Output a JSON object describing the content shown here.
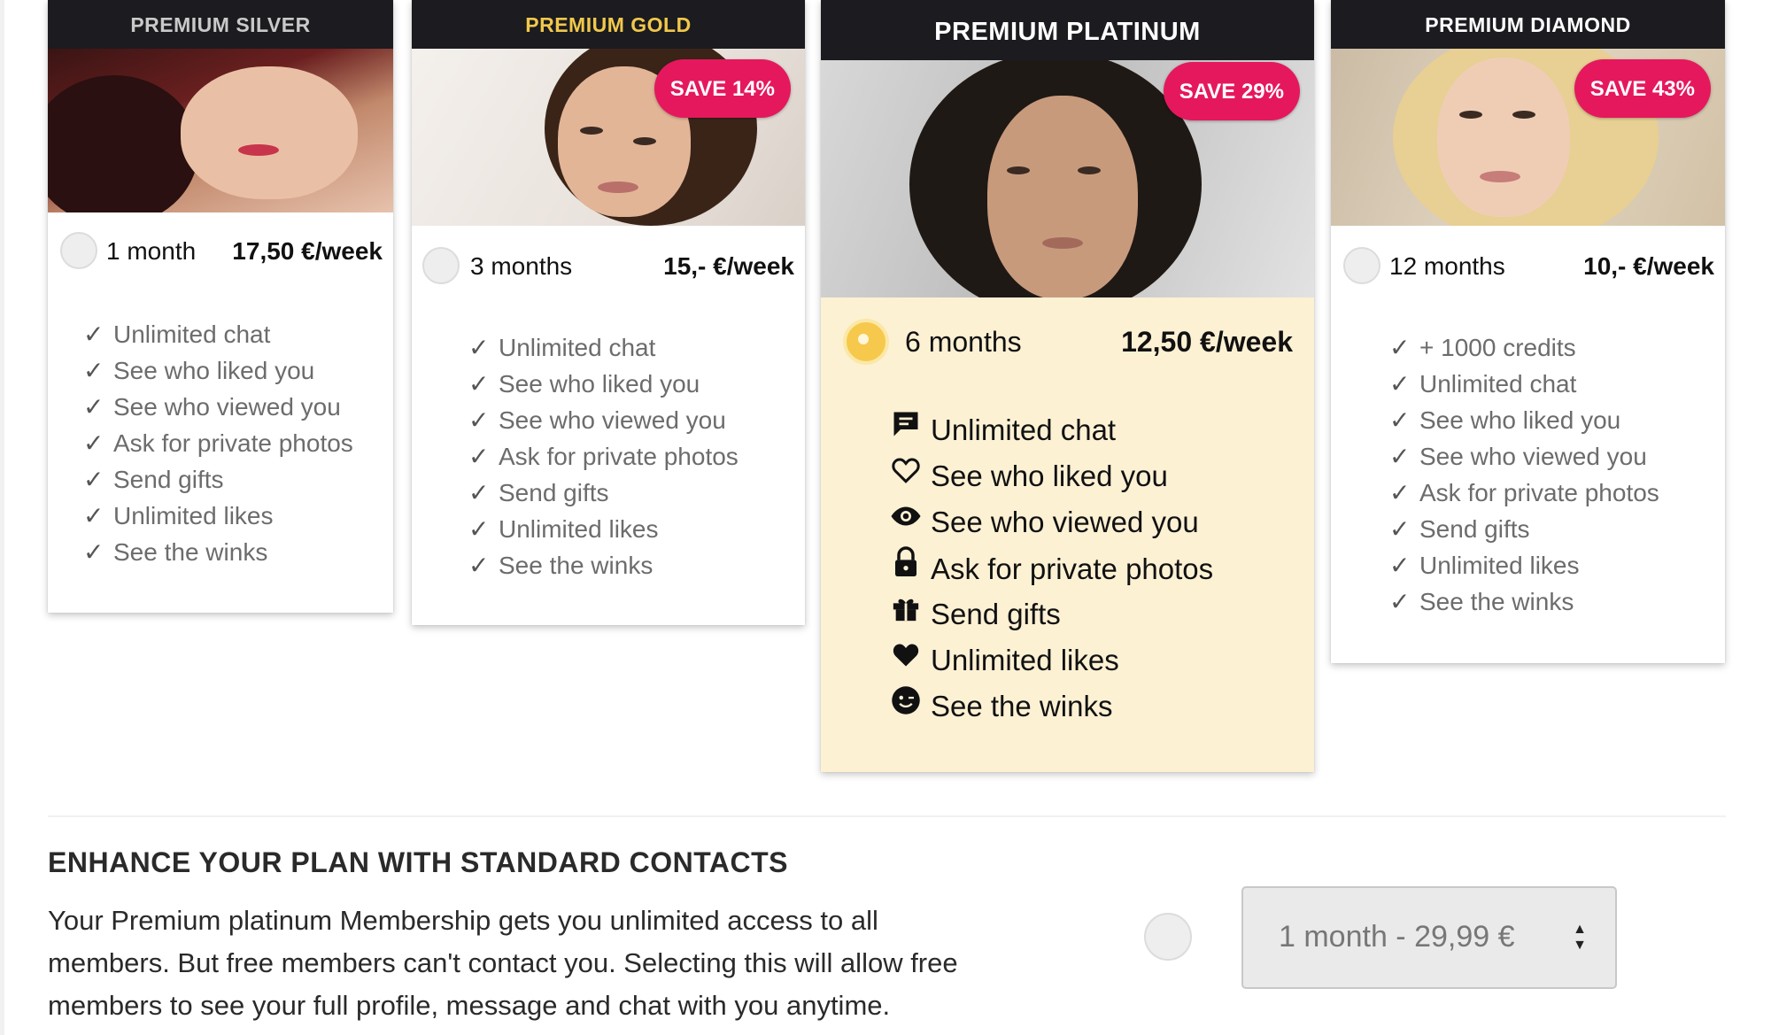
{
  "plans": [
    {
      "id": "silver",
      "header": "PREMIUM SILVER",
      "duration": "1 month",
      "price": "17,50 €/week",
      "features": [
        "Unlimited chat",
        "See who liked you",
        "See who viewed you",
        "Ask for private photos",
        "Send gifts",
        "Unlimited likes",
        "See the winks"
      ]
    },
    {
      "id": "gold",
      "header": "PREMIUM GOLD",
      "badge": "SAVE 14%",
      "duration": "3 months",
      "price": "15,- €/week",
      "features": [
        "Unlimited chat",
        "See who liked you",
        "See who viewed you",
        "Ask for private photos",
        "Send gifts",
        "Unlimited likes",
        "See the winks"
      ]
    },
    {
      "id": "platinum",
      "header": "PREMIUM PLATINUM",
      "badge": "SAVE 29%",
      "duration": "6 months",
      "price": "12,50 €/week",
      "selected": true,
      "features": [
        {
          "icon": "chat-icon",
          "label": "Unlimited chat"
        },
        {
          "icon": "heart-outline-icon",
          "label": "See who liked you"
        },
        {
          "icon": "eye-icon",
          "label": "See who viewed you"
        },
        {
          "icon": "lock-icon",
          "label": "Ask for private photos"
        },
        {
          "icon": "gift-icon",
          "label": "Send gifts"
        },
        {
          "icon": "heart-icon",
          "label": "Unlimited likes"
        },
        {
          "icon": "wink-icon",
          "label": "See the winks"
        }
      ]
    },
    {
      "id": "diamond",
      "header": "PREMIUM DIAMOND",
      "badge": "SAVE 43%",
      "duration": "12 months",
      "price": "10,- €/week",
      "features": [
        "+ 1000 credits",
        "Unlimited chat",
        "See who liked you",
        "See who viewed you",
        "Ask for private photos",
        "Send gifts",
        "Unlimited likes",
        "See the winks"
      ]
    }
  ],
  "enhance": {
    "title": "ENHANCE YOUR PLAN WITH STANDARD CONTACTS",
    "description_lines": [
      "Your Premium platinum Membership gets you unlimited access to all",
      "members. But free members can't contact you. Selecting this will allow free",
      "members to see your full profile, message and chat with you anytime."
    ],
    "select_value": "1 month - 29,99 €"
  },
  "colors": {
    "header_bg": "#1b1b20",
    "gold_text": "#f1c84b",
    "badge": "#e5185d",
    "highlight_bg": "#fdf1d4",
    "selected_radio": "#f6c94c"
  }
}
